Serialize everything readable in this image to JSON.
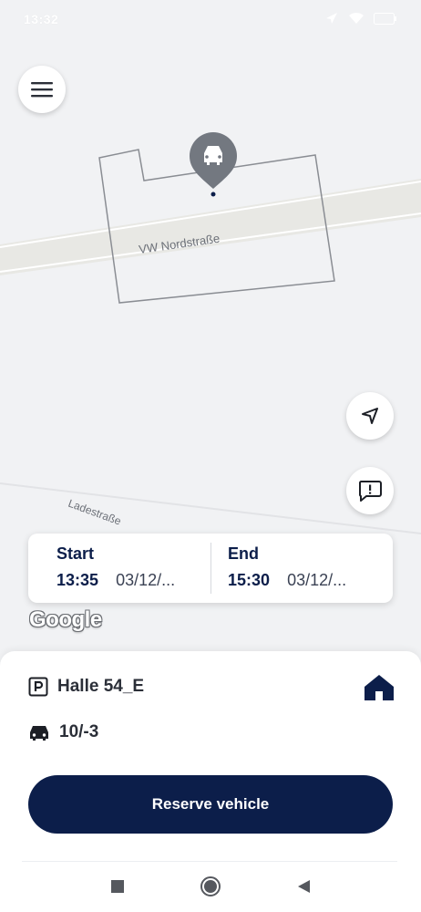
{
  "status_bar": {
    "time": "13:32"
  },
  "map": {
    "street_label_1": "VW Nordstraße",
    "street_label_2": "Ladestraße",
    "attribution": "Google"
  },
  "booking": {
    "start_label": "Start",
    "start_time": "13:35",
    "start_date": "03/12/...",
    "end_label": "End",
    "end_time": "15:30",
    "end_date": "03/12/..."
  },
  "sheet": {
    "parking_location": "Halle 54_E",
    "vehicle_spot": "10/-3",
    "reserve_label": "Reserve vehicle"
  },
  "colors": {
    "brand_navy": "#0c1e4a",
    "map_background": "#f1f2f4",
    "marker_gray": "#737880"
  }
}
